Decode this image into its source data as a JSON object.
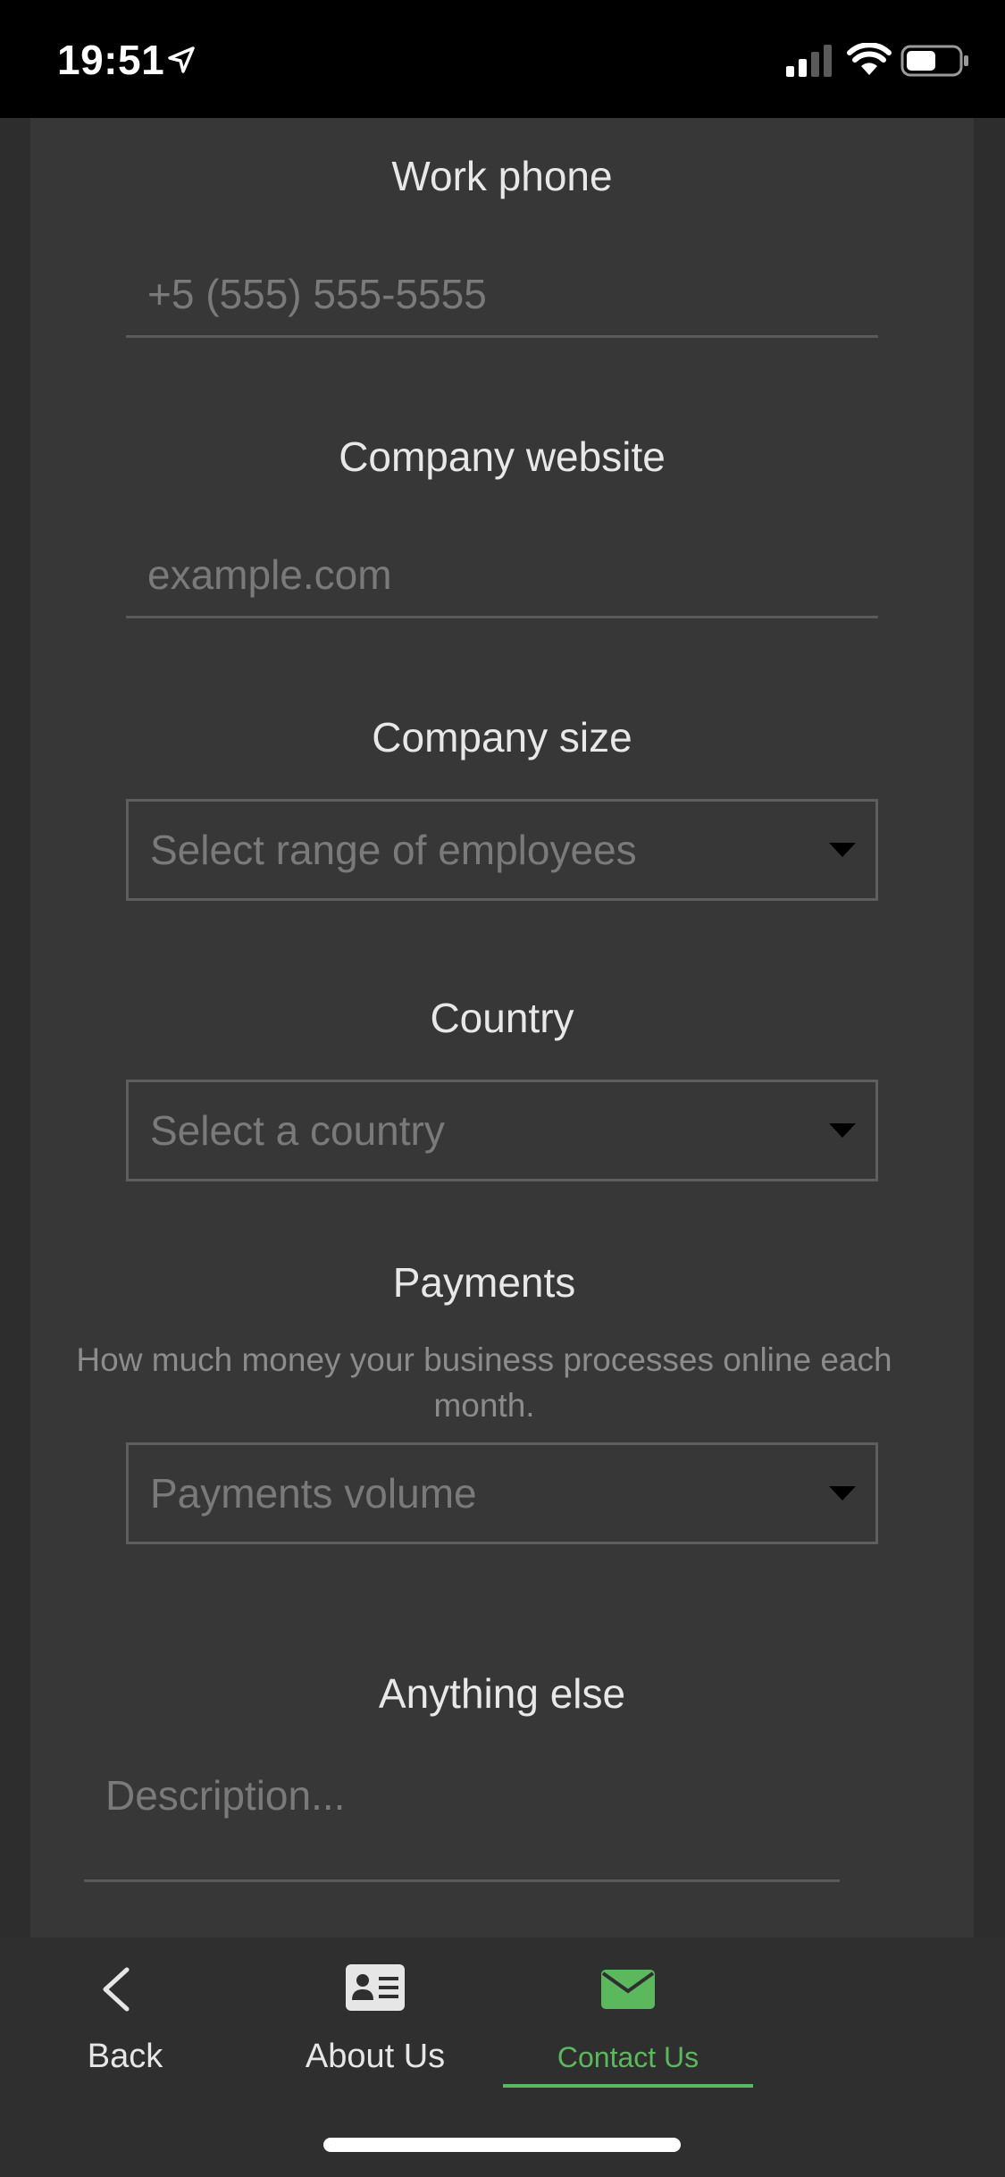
{
  "status_bar": {
    "time": "19:51"
  },
  "form": {
    "work_phone": {
      "label": "Work phone",
      "placeholder": "+5 (555) 555-5555"
    },
    "company_website": {
      "label": "Company website",
      "placeholder": "example.com"
    },
    "company_size": {
      "label": "Company size",
      "selected": "Select range of employees"
    },
    "country": {
      "label": "Country",
      "selected": "Select a country"
    },
    "payments": {
      "label": "Payments",
      "help": "How much money your business processes online each month.",
      "selected": "Payments volume"
    },
    "anything_else": {
      "label": "Anything else",
      "placeholder": "Description..."
    }
  },
  "bottom_nav": {
    "items": [
      {
        "label": "Back",
        "icon": "chevron-left-icon"
      },
      {
        "label": "About Us",
        "icon": "id-card-icon"
      },
      {
        "label": "Contact Us",
        "icon": "envelope-icon",
        "active": true
      }
    ],
    "active_color": "#5cb85c"
  }
}
